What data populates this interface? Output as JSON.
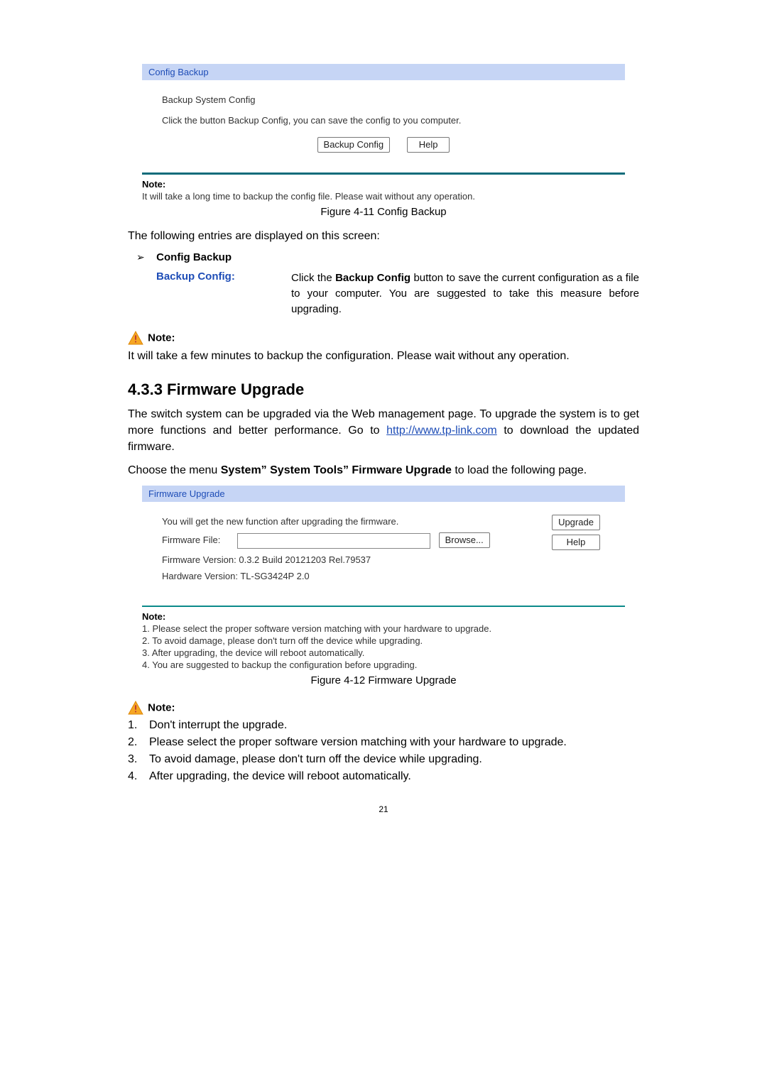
{
  "backup_panel": {
    "header": "Config Backup",
    "subhead": "Backup System Config",
    "desc": "Click the button Backup Config, you can save the config to you computer.",
    "btn_backup": "Backup Config",
    "btn_help": "Help",
    "note_label": "Note:",
    "note_text": "It will take a long time to backup the config file. Please wait without any operation."
  },
  "fig1_caption": "Figure 4-11 Config Backup",
  "screen_intro": "The following entries are displayed on this screen:",
  "bullet1_label": "Config Backup",
  "def1_term": "Backup Config:",
  "def1_desc_1": "Click the ",
  "def1_desc_bold": "Backup Config",
  "def1_desc_2": " button to save the current configuration as a file to your computer. You are suggested to take this measure before upgrading.",
  "note2_label": "Note:",
  "note2_text": "It will take a few minutes to backup the configuration. Please wait without any operation.",
  "heading": "4.3.3 Firmware Upgrade",
  "fw_para_1a": "The switch system can be upgraded via the Web management page. To upgrade the system is to get more functions and better performance. Go to ",
  "fw_para_link": "http://www.tp-link.com",
  "fw_para_1b": " to download the updated firmware.",
  "menu_line_1": "Choose the menu ",
  "menu_bold": "System”  System Tools”  Firmware Upgrade",
  "menu_line_2": " to load the following page.",
  "fw_panel": {
    "header": "Firmware Upgrade",
    "line_info": "You will get the new function after upgrading the firmware.",
    "file_label": "Firmware File:",
    "browse": "Browse...",
    "upgrade": "Upgrade",
    "help": "Help",
    "ver_label": "Firmware Version:",
    "ver_value": "0.3.2 Build 20121203 Rel.79537",
    "hw_label": "Hardware Version:",
    "hw_value": "TL-SG3424P 2.0",
    "note_label": "Note:",
    "notes": [
      "1. Please select the proper software version matching with your hardware to upgrade.",
      "2. To avoid damage, please don't turn off the device while upgrading.",
      "3. After upgrading, the device will reboot automatically.",
      "4. You are suggested to backup the configuration before upgrading."
    ]
  },
  "fig2_caption": "Figure 4-12 Firmware Upgrade",
  "note3_label": "Note:",
  "ol": [
    "Don't interrupt the upgrade.",
    "Please select the proper software version matching with your hardware to upgrade.",
    "To avoid damage, please don't turn off the device while upgrading.",
    "After upgrading, the device will reboot automatically."
  ],
  "page_number": "21"
}
